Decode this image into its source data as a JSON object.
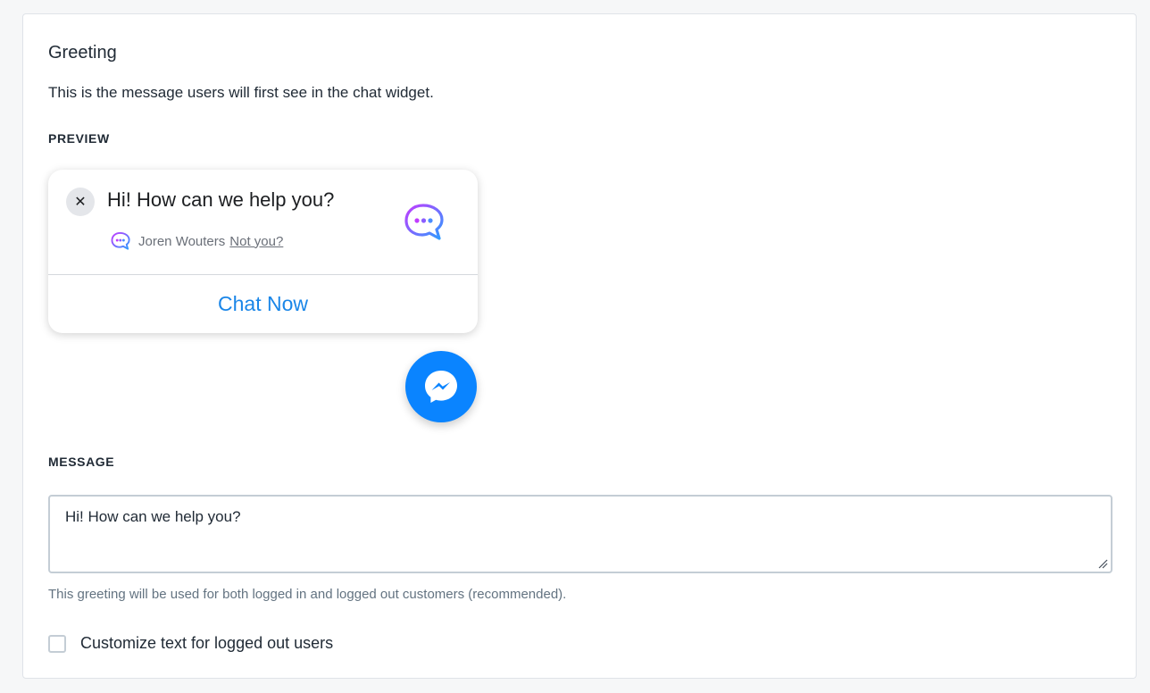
{
  "section": {
    "title": "Greeting",
    "description": "This is the message users will first see in the chat widget."
  },
  "preview": {
    "label": "PREVIEW",
    "close_glyph": "✕",
    "greeting": "Hi! How can we help you?",
    "user_name": "Joren Wouters",
    "not_you": "Not you?",
    "cta": "Chat Now",
    "brand_icon": "chat-bubble-dots-icon",
    "launcher_icon": "messenger-icon",
    "colors": {
      "cta_text": "#1a86e8",
      "launcher_bg": "#0a84ff",
      "brand_gradient_start": "#c13cff",
      "brand_gradient_end": "#2d9cff"
    }
  },
  "message": {
    "label": "MESSAGE",
    "value": "Hi! How can we help you?",
    "help": "This greeting will be used for both logged in and logged out customers (recommended)."
  },
  "customize": {
    "label": "Customize text for logged out users",
    "checked": false
  }
}
